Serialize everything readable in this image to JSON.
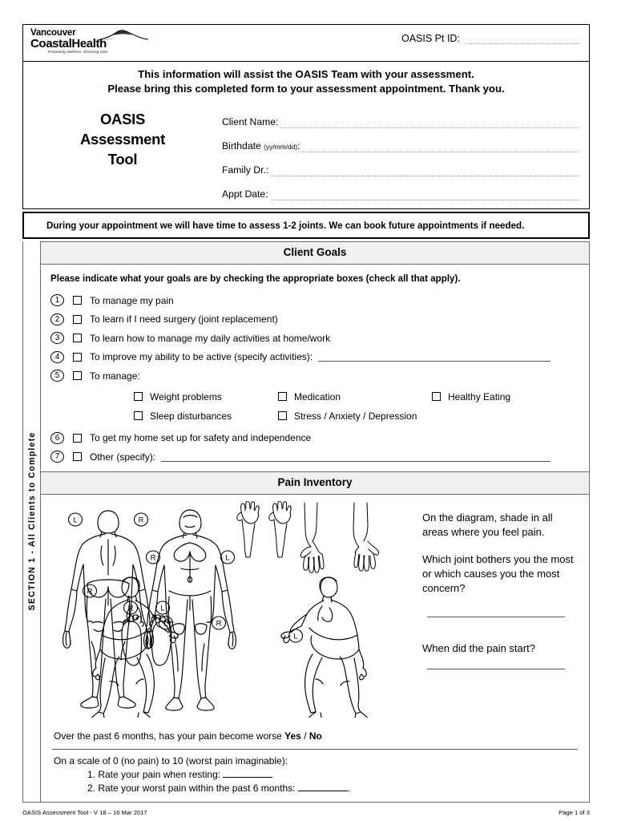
{
  "header": {
    "logo_line1": "Vancouver",
    "logo_line2_a": "Coastal",
    "logo_line2_b": "Health",
    "logo_tagline": "Promoting wellness. Ensuring care.",
    "pt_id_label": "OASIS Pt ID:"
  },
  "banner": {
    "line1": "This information will assist the OASIS Team with your assessment.",
    "line2": "Please bring this completed form to your assessment appointment. Thank you."
  },
  "title": {
    "line1": "OASIS",
    "line2": "Assessment",
    "line3": "Tool"
  },
  "fields": [
    {
      "label": "Client Name:",
      "small": "",
      "value": ""
    },
    {
      "label": "Birthdate",
      "small": "(yy/mm/dd)",
      "suffix": ":",
      "value": ""
    },
    {
      "label": "Family Dr.:",
      "small": "",
      "value": ""
    },
    {
      "label": "Appt Date:",
      "small": "",
      "value": ""
    }
  ],
  "notice": "During your appointment we will have time to assess 1-2 joints. We can book future appointments if needed.",
  "sidebar": {
    "label": "SECTION 1  -  All Clients to Complete"
  },
  "client_goals": {
    "header": "Client Goals",
    "intro": "Please indicate what your goals are by checking the appropriate boxes (check all that apply).",
    "items": [
      {
        "num": "1",
        "label": "To manage my pain",
        "has_fill": false
      },
      {
        "num": "2",
        "label": "To learn if I need surgery (joint replacement)",
        "has_fill": false
      },
      {
        "num": "3",
        "label": "To learn how to manage my daily activities at home/work",
        "has_fill": false
      },
      {
        "num": "4",
        "label": "To improve my ability to be active (specify activities):",
        "has_fill": true
      },
      {
        "num": "5",
        "label": "To manage:",
        "has_fill": false
      },
      {
        "num": "6",
        "label": "To get my home set up for safety and independence",
        "has_fill": false
      },
      {
        "num": "7",
        "label": "Other (specify):",
        "has_fill": true
      }
    ],
    "sub_options": [
      [
        "Weight problems",
        "Medication",
        "Healthy Eating"
      ],
      [
        "Sleep disturbances",
        "Stress / Anxiety / Depression",
        ""
      ]
    ]
  },
  "pain_inventory": {
    "header": "Pain Inventory",
    "instruction": "On the diagram, shade in all areas where you feel pain.",
    "question1": "Which joint bothers you the most or which causes you the most concern?",
    "question2": "When did the pain start?",
    "worse_q_a": "Over the past 6 months, has your pain become worse ",
    "worse_yes": "Yes",
    "worse_sep": " / ",
    "worse_no": "No",
    "scale_intro": "On a scale of 0 (no pain) to 10 (worst pain imaginable):",
    "scale_q1": "1. Rate your pain when resting:",
    "scale_q2a": "2. Rate your worst pain within the past 6 months:",
    "scale_q2b": ".",
    "figure_labels": {
      "back_left": "L",
      "back_right": "R",
      "front_right": "R",
      "front_left": "L",
      "foot_right": "R",
      "foot_left": "L",
      "side_a_right": "R",
      "side_a_left": "L",
      "side_b_right": "R",
      "side_b_left": "L"
    }
  },
  "footer": {
    "left": "OASIS Assessment Tool - V 18 – 16 Mar 2017",
    "right": "Page 1 of 3"
  }
}
